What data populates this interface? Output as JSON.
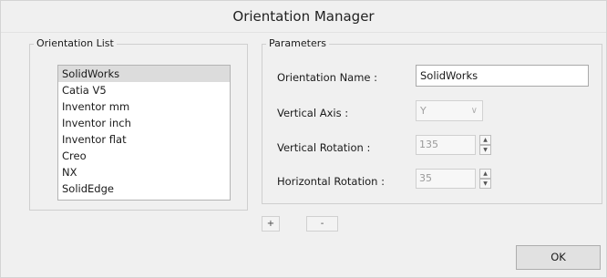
{
  "window": {
    "title": "Orientation Manager"
  },
  "orientation_list": {
    "label": "Orientation List",
    "items": [
      {
        "label": "SolidWorks",
        "selected": true
      },
      {
        "label": "Catia V5",
        "selected": false
      },
      {
        "label": "Inventor mm",
        "selected": false
      },
      {
        "label": "Inventor inch",
        "selected": false
      },
      {
        "label": "Inventor flat",
        "selected": false
      },
      {
        "label": "Creo",
        "selected": false
      },
      {
        "label": "NX",
        "selected": false
      },
      {
        "label": "SolidEdge",
        "selected": false
      }
    ]
  },
  "parameters": {
    "label": "Parameters",
    "orientation_name": {
      "label": "Orientation Name :",
      "value": "SolidWorks"
    },
    "vertical_axis": {
      "label": "Vertical Axis :",
      "value": "Y",
      "icon": "chevron-down-icon",
      "enabled": false
    },
    "vertical_rotation": {
      "label": "Vertical Rotation :",
      "value": "135",
      "enabled": false
    },
    "horizontal_rotation": {
      "label": "Horizontal Rotation :",
      "value": "35",
      "enabled": false
    }
  },
  "actions": {
    "add_label": "+",
    "remove_label": "-",
    "ok_label": "OK"
  },
  "colors": {
    "window_bg": "#f0f0f0",
    "selection_bg": "#dcdcdc",
    "disabled_text": "#a0a0a0"
  }
}
